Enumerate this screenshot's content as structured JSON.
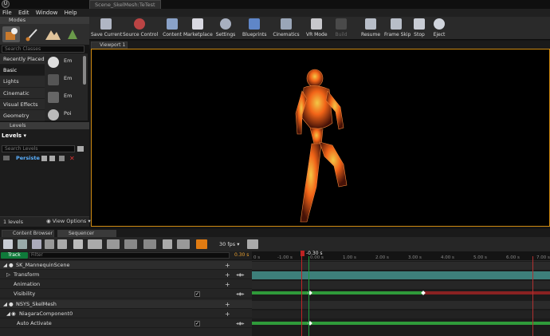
{
  "window": {
    "title_tab": "Scene_SkelMesh:TeTest"
  },
  "menubar": {
    "items": [
      "File",
      "Edit",
      "Window",
      "Help"
    ]
  },
  "modes": {
    "header": "Modes",
    "search_placeholder": "Search Classes",
    "categories": [
      "Recently Placed",
      "Basic",
      "Lights",
      "Cinematic",
      "Visual Effects",
      "Geometry"
    ],
    "selected_category": "Basic",
    "items": [
      "Em",
      "Em",
      "Em",
      "Poi"
    ]
  },
  "levels": {
    "header": "Levels",
    "dropdown": "Levels",
    "search_placeholder": "Search Levels",
    "persistent": "Persiste",
    "count": "1 levels",
    "view_options": "View Options"
  },
  "toolbar": {
    "buttons": [
      {
        "label": "Save Current",
        "icon": "save-icon"
      },
      {
        "label": "Source Control",
        "icon": "source-control-icon"
      },
      {
        "label": "Content",
        "icon": "content-icon"
      },
      {
        "label": "Marketplace",
        "icon": "marketplace-icon"
      },
      {
        "label": "Settings",
        "icon": "settings-icon"
      },
      {
        "label": "Blueprints",
        "icon": "blueprints-icon"
      },
      {
        "label": "Cinematics",
        "icon": "cinematics-icon"
      },
      {
        "label": "VR Mode",
        "icon": "vr-icon"
      },
      {
        "label": "Build",
        "icon": "build-icon"
      },
      {
        "label": "Resume",
        "icon": "resume-icon"
      },
      {
        "label": "Frame Skip",
        "icon": "frame-skip-icon"
      },
      {
        "label": "Stop",
        "icon": "stop-icon"
      },
      {
        "label": "Eject",
        "icon": "eject-icon"
      }
    ]
  },
  "viewport": {
    "tab": "Viewport 1"
  },
  "bottom_tabs": {
    "content_browser": "Content Browser",
    "sequencer": "Sequencer"
  },
  "sequencer": {
    "fps": "30 fps",
    "track_button": "Track",
    "filter_placeholder": "Filter",
    "current_time": "0.30 s",
    "playhead_label": "-0.30 s",
    "ruler_ticks": [
      "0 s",
      "-1.00 s",
      "0.00 s",
      "1.00 s",
      "2.00 s",
      "3.00 s",
      "4.00 s",
      "5.00 s",
      "6.00 s",
      "7.00 s"
    ],
    "rows": [
      {
        "label": "SK_MannequinScene",
        "kind": "actor"
      },
      {
        "label": "Transform",
        "kind": "track"
      },
      {
        "label": "Animation",
        "kind": "track"
      },
      {
        "label": "Visibility",
        "kind": "track",
        "checked": true
      },
      {
        "label": "NSYS_SkelMesh",
        "kind": "actor"
      },
      {
        "label": "NiagaraComponent0",
        "kind": "component"
      },
      {
        "label": "Auto Activate",
        "kind": "track",
        "checked": true
      }
    ]
  },
  "colors": {
    "accent": "#d08b12",
    "track_green": "#2f9a3a",
    "transform_teal": "#3d7f7a",
    "playhead": "#c02424"
  }
}
